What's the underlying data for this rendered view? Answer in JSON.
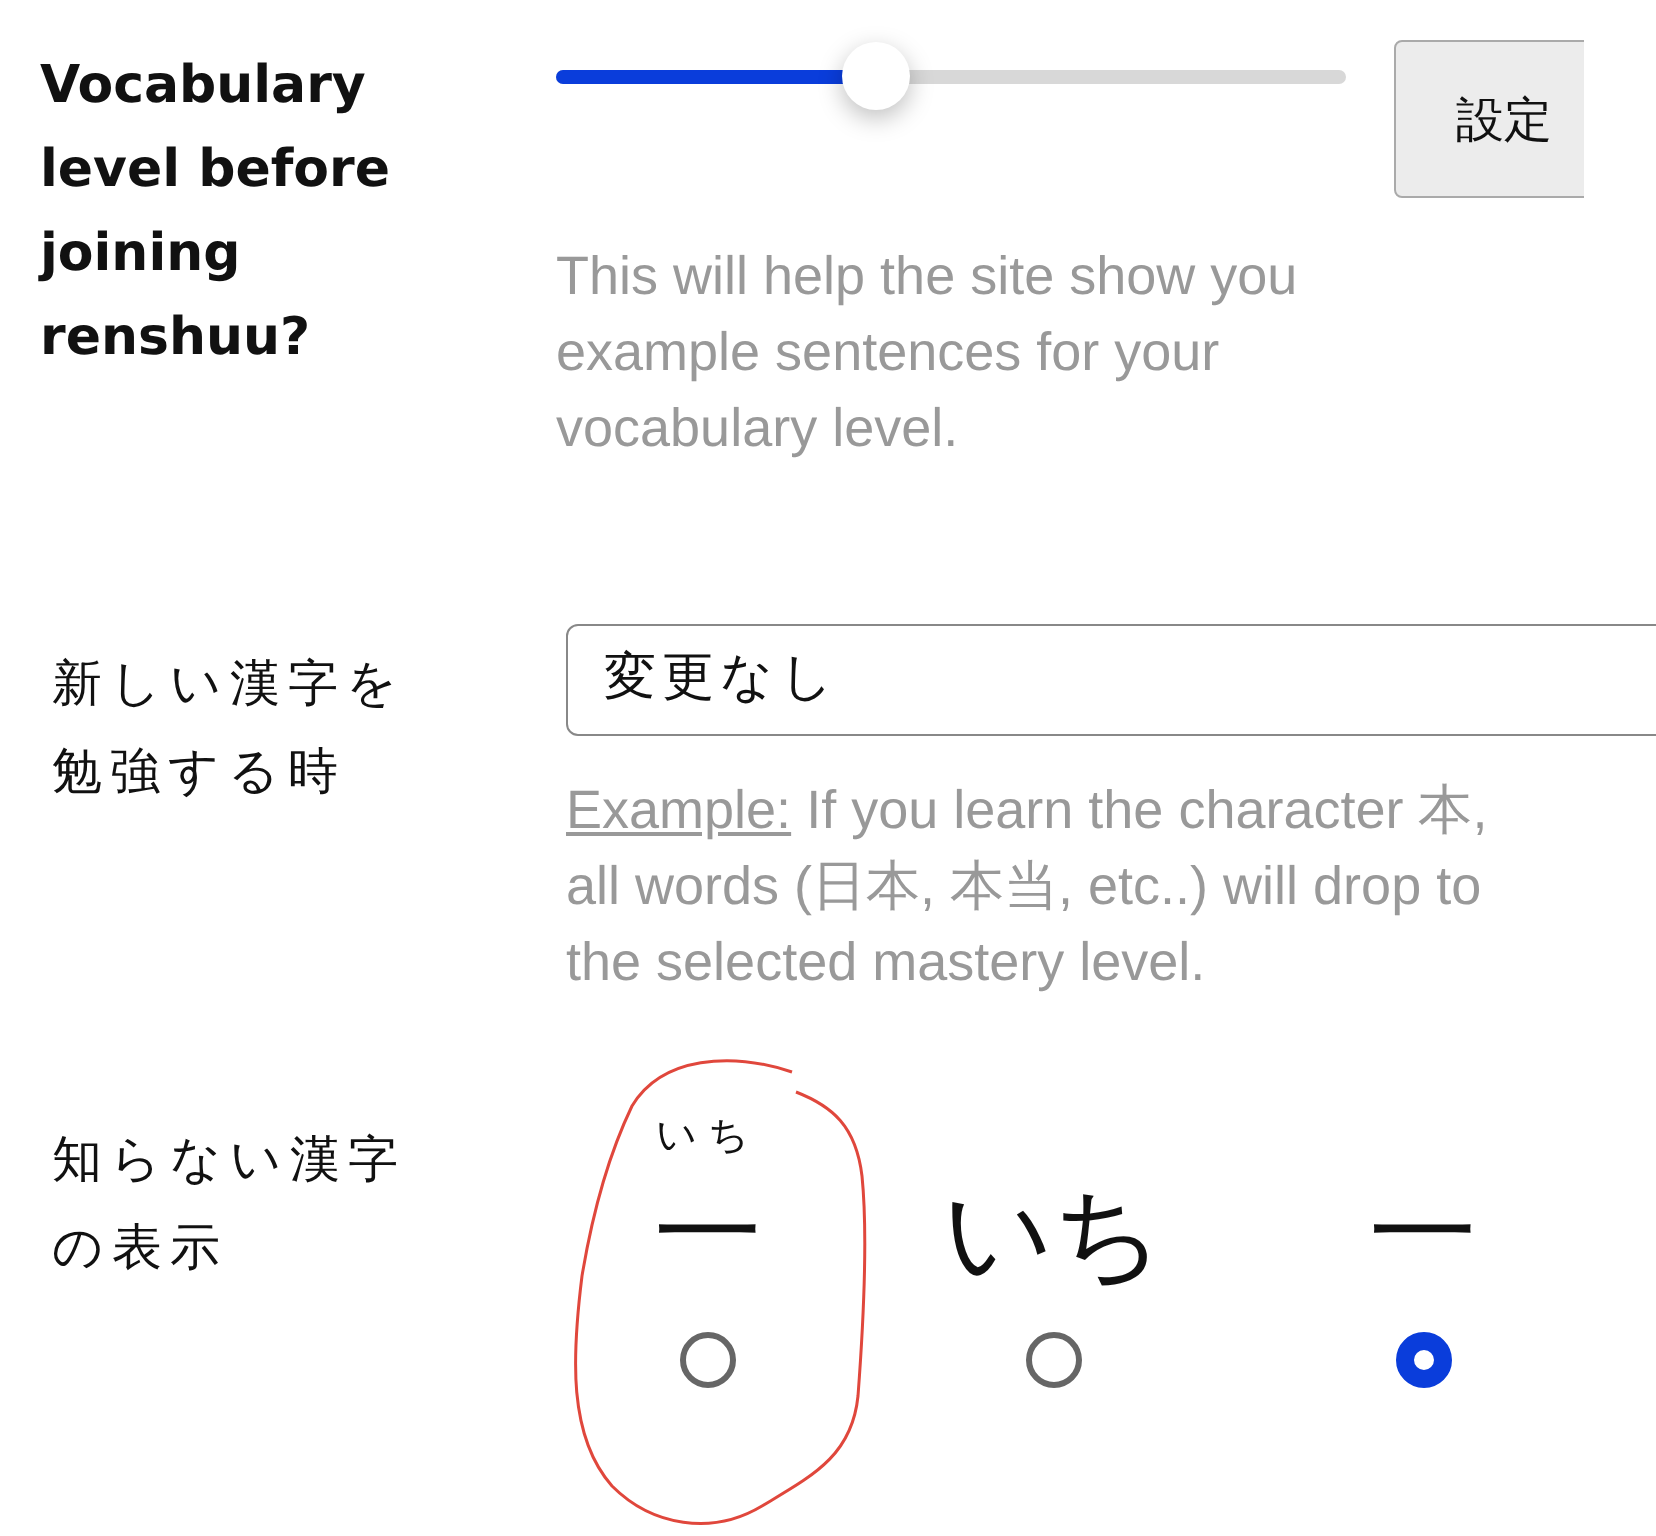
{
  "vocabulary_level": {
    "label": "Vocabulary level before joining renshuu?",
    "slider": {
      "level": 0.405
    },
    "button": "設定",
    "help": "This will help the site show you example sentences for your vocabulary level."
  },
  "new_kanji": {
    "label": "新しい漢字を勉強する時",
    "select": {
      "value": "変更なし"
    },
    "help_link": "Example:",
    "help": "If you learn the character 本, all words (日本, 本当, etc..) will drop to the selected mastery level."
  },
  "unknown_kanji": {
    "label": "知らない漢字の表示",
    "options": [
      {
        "kind": "ruby",
        "text": "一",
        "reading": "いち",
        "selected": false
      },
      {
        "kind": "plain",
        "text": "いち",
        "selected": false
      },
      {
        "kind": "plain",
        "text": "一",
        "selected": true
      }
    ]
  }
}
